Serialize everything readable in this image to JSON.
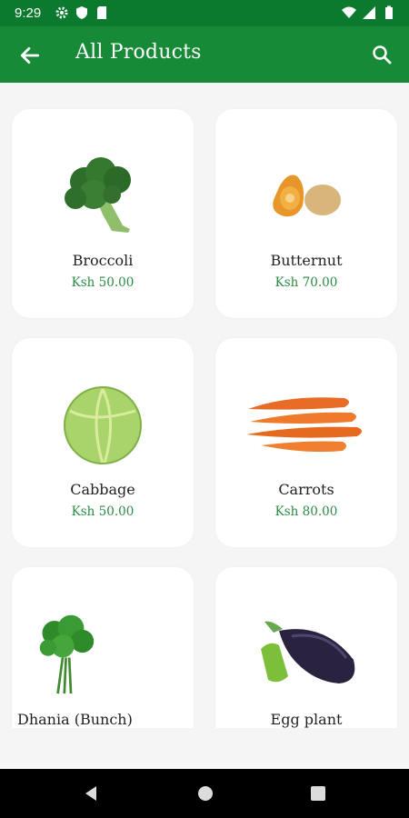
{
  "status_bar": {
    "time": "9:29"
  },
  "app_bar": {
    "title": "All Products"
  },
  "products": [
    {
      "name": "Broccoli",
      "price": "Ksh 50.00",
      "icon": "broccoli-image"
    },
    {
      "name": "Butternut",
      "price": "Ksh 70.00",
      "icon": "butternut-image"
    },
    {
      "name": "Cabbage",
      "price": "Ksh 50.00",
      "icon": "cabbage-image"
    },
    {
      "name": "Carrots",
      "price": "Ksh 80.00",
      "icon": "carrots-image"
    },
    {
      "name": "Dhania (Bunch)",
      "price": "",
      "icon": "dhania-image"
    },
    {
      "name": "Egg plant",
      "price": "",
      "icon": "eggplant-image"
    }
  ],
  "colors": {
    "status_bar": "#0b7a2f",
    "app_bar": "#168a36",
    "price": "#2b8a44"
  }
}
